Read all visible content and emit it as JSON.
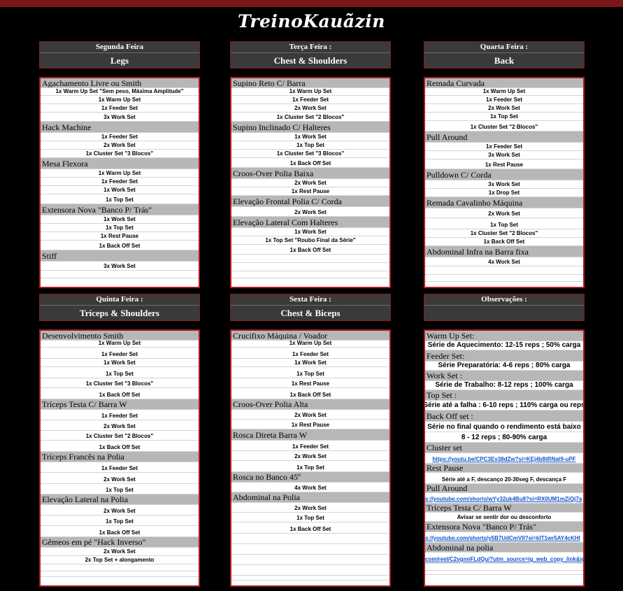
{
  "title": "TreinoKauãzin",
  "days": [
    {
      "day": "Segunda Feira",
      "group": "Legs",
      "rows": [
        {
          "t": "ex",
          "text": "Agachamento Livre ou Smith"
        },
        {
          "t": "st",
          "text": "1x Warm Up Set \"Sem peso, Máxima Amplitude\""
        },
        {
          "t": "st",
          "text": "1x Warm Up Set"
        },
        {
          "t": "st",
          "text": "1x Feeder Set"
        },
        {
          "t": "st",
          "text": "3x Work Set"
        },
        {
          "t": "ex",
          "text": "Hack Machine"
        },
        {
          "t": "st",
          "text": "1x Feeder Set"
        },
        {
          "t": "st",
          "text": "2x Work Set"
        },
        {
          "t": "st",
          "text": "1x Cluster Set \"3 Blocos\""
        },
        {
          "t": "ex",
          "text": "Mesa Flexora"
        },
        {
          "t": "st",
          "text": "1x Warm Up Set"
        },
        {
          "t": "st",
          "text": "1x Feeder Set"
        },
        {
          "t": "st",
          "text": "1x Work Set"
        },
        {
          "t": "st",
          "text": "1x Top Set"
        },
        {
          "t": "ex",
          "text": "Extensora Nova \"Banco P/ Trás\""
        },
        {
          "t": "st",
          "text": "1x Work Set"
        },
        {
          "t": "st",
          "text": "1x Top Set"
        },
        {
          "t": "st",
          "text": "1x Rest Pause"
        },
        {
          "t": "st",
          "text": "1x Back Off Set"
        },
        {
          "t": "ex",
          "text": "Stiff"
        },
        {
          "t": "st",
          "text": "3x Work Set"
        },
        {
          "t": "st",
          "text": ""
        }
      ]
    },
    {
      "day": "Terça Feira :",
      "group": "Chest & Shoulders",
      "rows": [
        {
          "t": "ex",
          "text": "Supino Reto C/ Barra"
        },
        {
          "t": "st",
          "text": "1x Warm Up Set"
        },
        {
          "t": "st",
          "text": "1x Feeder Set"
        },
        {
          "t": "st",
          "text": "2x Work Set"
        },
        {
          "t": "st",
          "text": "1x Cluster Set \"2 Blocos\""
        },
        {
          "t": "ex",
          "text": "Supino Inclinado C/ Halteres"
        },
        {
          "t": "st",
          "text": "1x Work Set"
        },
        {
          "t": "st",
          "text": "1x Top Set"
        },
        {
          "t": "st",
          "text": "1x Cluster Set \"3 Blocos\""
        },
        {
          "t": "st",
          "text": "1x Back Off Set"
        },
        {
          "t": "ex",
          "text": "Croos-Over Polia Baixa"
        },
        {
          "t": "st",
          "text": "2x Work Set"
        },
        {
          "t": "st",
          "text": "1x Rest Pause"
        },
        {
          "t": "ex",
          "text": "Elevação Frontal Polia C/ Corda"
        },
        {
          "t": "st",
          "text": "2x Work Set"
        },
        {
          "t": "ex",
          "text": "Elevação Lateral Com Halteres"
        },
        {
          "t": "st",
          "text": "1x Work Set"
        },
        {
          "t": "st",
          "text": "1x Top Set \"Roubo Final da Série\""
        },
        {
          "t": "st",
          "text": "1x Back Off Set"
        },
        {
          "t": "st",
          "text": ""
        },
        {
          "t": "st",
          "text": ""
        },
        {
          "t": "st",
          "text": ""
        }
      ]
    },
    {
      "day": "Quarta Feira :",
      "group": "Back",
      "rows": [
        {
          "t": "ex",
          "text": "Remada Curvada"
        },
        {
          "t": "st",
          "text": "1x Warm Up Set"
        },
        {
          "t": "st",
          "text": "1x Feeder Set"
        },
        {
          "t": "st",
          "text": "2x Work Set"
        },
        {
          "t": "st",
          "text": "1x Top Set"
        },
        {
          "t": "st",
          "text": "1x Cluster Set \"2 Blocos\""
        },
        {
          "t": "ex",
          "text": "Pull Around"
        },
        {
          "t": "st",
          "text": "1x Feeder Set"
        },
        {
          "t": "st",
          "text": "3x Work Set"
        },
        {
          "t": "st",
          "text": "1x Rest Pause"
        },
        {
          "t": "ex",
          "text": "Pulldown C/ Corda"
        },
        {
          "t": "st",
          "text": "3x Work Set"
        },
        {
          "t": "st",
          "text": "1x Drop Set"
        },
        {
          "t": "ex",
          "text": "Remada Cavalinho Máquina"
        },
        {
          "t": "st",
          "text": "2x Work Set"
        },
        {
          "t": "st",
          "text": "1x Top Set"
        },
        {
          "t": "st",
          "text": "1x Cluster Set \"2 Blocos\""
        },
        {
          "t": "st",
          "text": "1x Back Off Set"
        },
        {
          "t": "ex",
          "text": "Abdominal Infra na Barra fixa"
        },
        {
          "t": "st",
          "text": "4x Work Set"
        },
        {
          "t": "st",
          "text": ""
        },
        {
          "t": "st",
          "text": ""
        }
      ]
    },
    {
      "day": "Quinta Feira :",
      "group": "Tríceps & Shoulders",
      "rows": [
        {
          "t": "ex",
          "text": "Desenvolvimento Smith"
        },
        {
          "t": "st",
          "text": "1x Warm Up Set"
        },
        {
          "t": "st",
          "text": "1x Feeder Set"
        },
        {
          "t": "st",
          "text": "1x Work Set"
        },
        {
          "t": "st",
          "text": "1x Top Set"
        },
        {
          "t": "st",
          "text": "1x Cluster Set \"3 Blocos\""
        },
        {
          "t": "st",
          "text": "1x Back Off Set"
        },
        {
          "t": "ex",
          "text": "Tríceps Testa C/ Barra W"
        },
        {
          "t": "st",
          "text": "1x Feeder Set"
        },
        {
          "t": "st",
          "text": "2x Work Set"
        },
        {
          "t": "st",
          "text": "1x Cluster Set \"2 Blocos\""
        },
        {
          "t": "st",
          "text": "1x Back Off Set"
        },
        {
          "t": "ex",
          "text": "Tríceps Francês na Polia"
        },
        {
          "t": "st",
          "text": "1x Feeder Set"
        },
        {
          "t": "st",
          "text": "2x Work Set"
        },
        {
          "t": "st",
          "text": "1x Top Set"
        },
        {
          "t": "ex",
          "text": "Elevação Lateral na Polia"
        },
        {
          "t": "st",
          "text": "2x Work Set"
        },
        {
          "t": "st",
          "text": "1x Top Set"
        },
        {
          "t": "st",
          "text": "1x Back Off Set"
        },
        {
          "t": "ex",
          "text": "Gêmeos em pé \"Hack Inverso\""
        },
        {
          "t": "st",
          "text": "2x Work Set"
        },
        {
          "t": "st",
          "text": "2x Top Set + alongamento"
        },
        {
          "t": "st",
          "text": ""
        },
        {
          "t": "st",
          "text": ""
        }
      ]
    },
    {
      "day": "Sexta Feira :",
      "group": "Chest & Biceps",
      "rows": [
        {
          "t": "ex",
          "text": "Crucifixo Máquina / Voador"
        },
        {
          "t": "st",
          "text": "1x Warm Up Set"
        },
        {
          "t": "st",
          "text": "1x Feeder Set"
        },
        {
          "t": "st",
          "text": "1x Work Set"
        },
        {
          "t": "st",
          "text": "1x Top Set"
        },
        {
          "t": "st",
          "text": "1x Rest Pause"
        },
        {
          "t": "st",
          "text": "1x Back Off Set"
        },
        {
          "t": "ex",
          "text": "Croos-Over Polia Alta"
        },
        {
          "t": "st",
          "text": "2x Work Set"
        },
        {
          "t": "st",
          "text": "1x Rest Pause"
        },
        {
          "t": "ex",
          "text": "Rosca Direta Barra W"
        },
        {
          "t": "st",
          "text": "1x Feeder Set"
        },
        {
          "t": "st",
          "text": "2x Work Set"
        },
        {
          "t": "st",
          "text": "1x Top Set"
        },
        {
          "t": "ex",
          "text": "Rosca no Banco 45º"
        },
        {
          "t": "st",
          "text": "4x Work Set"
        },
        {
          "t": "ex",
          "text": "Abdominal na Polia"
        },
        {
          "t": "st",
          "text": "2x Work Set"
        },
        {
          "t": "st",
          "text": "1x Top Set"
        },
        {
          "t": "st",
          "text": "1x Back Off Set"
        },
        {
          "t": "st",
          "text": ""
        },
        {
          "t": "st",
          "text": ""
        },
        {
          "t": "st",
          "text": ""
        },
        {
          "t": "st",
          "text": ""
        },
        {
          "t": "st",
          "text": ""
        }
      ]
    },
    {
      "day": "Observações :",
      "group": "",
      "rows": [
        {
          "t": "ex",
          "text": "Warm Up Set:"
        },
        {
          "t": "st",
          "big": true,
          "text": "Série de Aquecimento: 12-15 reps ; 50% carga"
        },
        {
          "t": "ex",
          "text": "Feeder Set:"
        },
        {
          "t": "st",
          "big": true,
          "text": "Série Preparatória: 4-6 reps ; 80% carga"
        },
        {
          "t": "ex",
          "text": "Work Set :"
        },
        {
          "t": "st",
          "big": true,
          "text": "Série de Trabalho: 8-12 reps ; 100% carga"
        },
        {
          "t": "ex",
          "text": "Top Set :"
        },
        {
          "t": "st",
          "big": true,
          "text": "Série até a falha : 6-10 reps ; 110% carga ou reps"
        },
        {
          "t": "ex",
          "text": "Back Off set :"
        },
        {
          "t": "st",
          "big": true,
          "text": "Série no final quando o rendimento está baixo"
        },
        {
          "t": "st",
          "big": true,
          "text": "8 - 12 reps ; 80-90% carga"
        },
        {
          "t": "ex",
          "text": "Cluster set"
        },
        {
          "t": "st",
          "link": true,
          "text": "https://youtu.be/CPC3Ev38dZw?si=KEj4b8tRNat9-uPF"
        },
        {
          "t": "ex",
          "text": "Rest Pause"
        },
        {
          "t": "st",
          "text": "Série até a F, descanço 20-30seg F, descança F"
        },
        {
          "t": "ex",
          "text": "Pull Around"
        },
        {
          "t": "st",
          "link": true,
          "left": true,
          "text": "s://youtube.com/shorts/wYy32uk4Bu8?si=RX0UM1mZiQj7a"
        },
        {
          "t": "ex",
          "text": "Tríceps Testa C/ Barra W"
        },
        {
          "t": "st",
          "text": "Avisar se sentir dor ou desconforto"
        },
        {
          "t": "ex",
          "text": "Extensora Nova \"Banco P/ Trás\""
        },
        {
          "t": "st",
          "link": true,
          "left": true,
          "text": "s://youtube.com/shorts/y5B7UdCmVlI?si=kIT1wr5AY4cKHI"
        },
        {
          "t": "ex",
          "text": "Abdominal na polia"
        },
        {
          "t": "st",
          "link": true,
          "left": true,
          "text": "com/reel/C2vgnnFLdQu/?utm_source=ig_web_copy_link&ig"
        },
        {
          "t": "st",
          "text": ""
        },
        {
          "t": "st",
          "text": ""
        }
      ]
    }
  ]
}
